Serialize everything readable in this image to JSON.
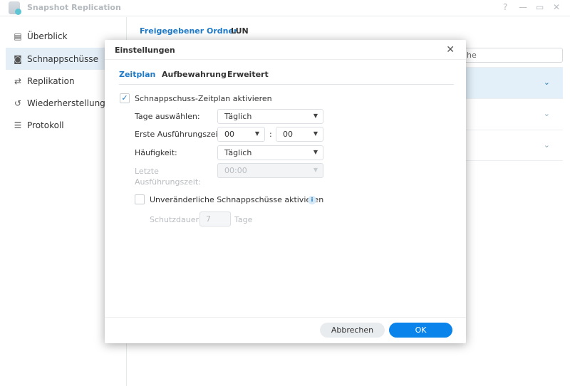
{
  "app": {
    "title": "Snapshot Replication",
    "help": "?",
    "minimize": "—",
    "maximize": "▭",
    "close": "✕"
  },
  "sidebar": {
    "items": [
      {
        "label": "Überblick",
        "icon": "overview-icon",
        "glyph": "▤"
      },
      {
        "label": "Schnappschüsse",
        "icon": "camera-icon",
        "glyph": "◙"
      },
      {
        "label": "Replikation",
        "icon": "replication-icon",
        "glyph": "⇄"
      },
      {
        "label": "Wiederherstellung",
        "icon": "restore-icon",
        "glyph": "↺"
      },
      {
        "label": "Protokoll",
        "icon": "list-icon",
        "glyph": "☰"
      }
    ]
  },
  "main": {
    "tabs": [
      "Freigegebener Ordner",
      "LUN"
    ],
    "search_partial": "he",
    "chevron": "⌄"
  },
  "dialog": {
    "title": "Einstellungen",
    "close": "✕",
    "tabs": [
      "Zeitplan",
      "Aufbewahrung",
      "Erweitert"
    ],
    "enable_schedule": "Schnappschuss-Zeitplan aktivieren",
    "check": "✓",
    "days_label": "Tage auswählen:",
    "days_value": "Täglich",
    "first_run_label": "Erste Ausführungszeit:",
    "hour": "00",
    "minute": "00",
    "colon": ":",
    "freq_label": "Häufigkeit:",
    "freq_value": "Täglich",
    "last_run_label1": "Letzte",
    "last_run_label2": "Ausführungszeit:",
    "last_run_value": "00:00",
    "immutable_label": "Unveränderliche Schnappschüsse aktivieren",
    "info": "i",
    "protect_label": "Schutzdauer:",
    "protect_value": "7",
    "protect_unit": "Tage",
    "cancel": "Abbrechen",
    "ok": "OK",
    "arrow": "▼"
  },
  "colors": {
    "accent": "#1e7ac7",
    "ok_button": "#0a84ea"
  }
}
